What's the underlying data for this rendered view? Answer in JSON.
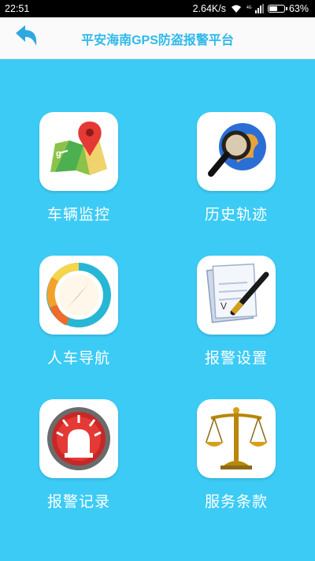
{
  "status_bar": {
    "time": "22:51",
    "speed": "2.64K/s",
    "battery": "63%",
    "battery_level": 0.63
  },
  "header": {
    "title": "平安海南GPS防盗报警平台",
    "back_icon": "back-arrow-icon"
  },
  "menu": [
    {
      "label": "车辆监控",
      "icon": "map-pin-icon"
    },
    {
      "label": "历史轨迹",
      "icon": "globe-magnifier-icon"
    },
    {
      "label": "人车导航",
      "icon": "compass-icon"
    },
    {
      "label": "报警设置",
      "icon": "document-pen-icon"
    },
    {
      "label": "报警记录",
      "icon": "alarm-siren-icon"
    },
    {
      "label": "服务条款",
      "icon": "scales-icon"
    }
  ],
  "colors": {
    "background": "#3ccbf5",
    "title": "#2fb9ea",
    "header_bg": "#fafafa"
  }
}
